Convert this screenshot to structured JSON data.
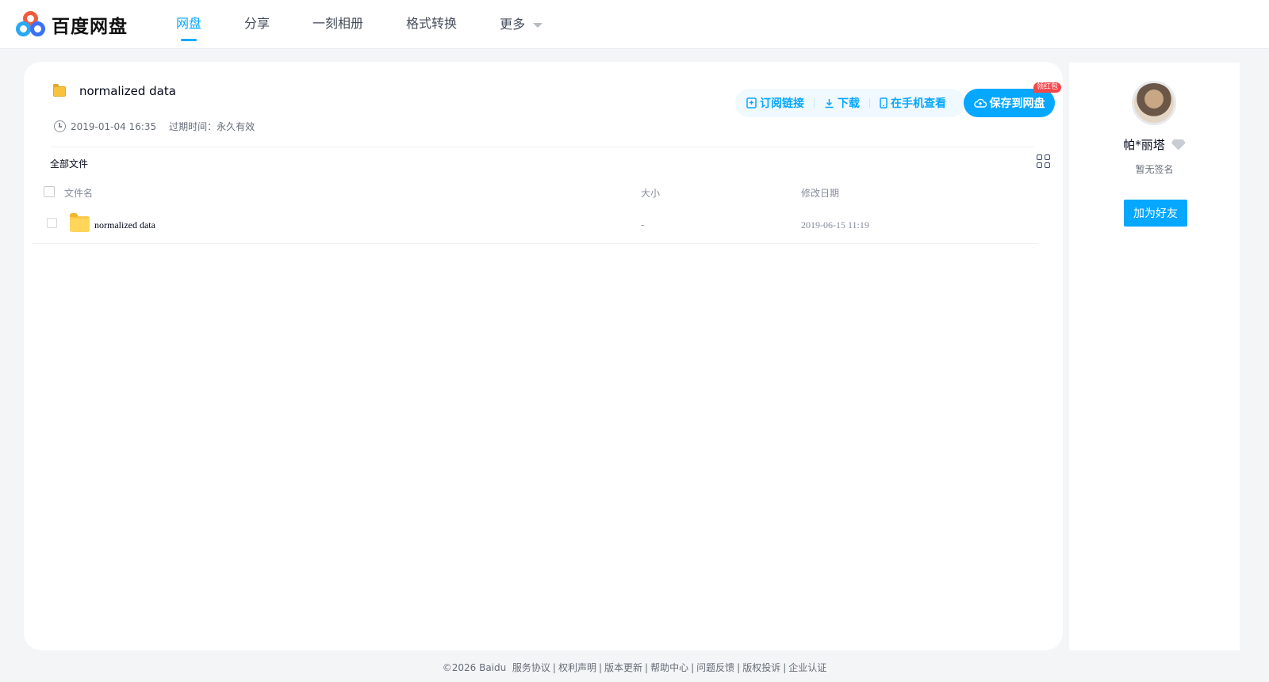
{
  "brand": {
    "name": "百度网盘"
  },
  "nav": {
    "items": [
      {
        "label": "网盘",
        "active": true
      },
      {
        "label": "分享",
        "active": false
      },
      {
        "label": "一刻相册",
        "active": false
      },
      {
        "label": "格式转换",
        "active": false
      }
    ],
    "more_label": "更多"
  },
  "share": {
    "title": "normalized data",
    "created": "2019-01-04 16:35",
    "expire": "过期时间：永久有效"
  },
  "actions": {
    "subscribe": "订阅链接",
    "download": "下载",
    "mobile": "在手机查看",
    "save": "保存到网盘",
    "redpack_badge": "领红包"
  },
  "file_list": {
    "breadcrumb": "全部文件",
    "columns": {
      "name": "文件名",
      "size": "大小",
      "date": "修改日期"
    },
    "rows": [
      {
        "name": "normalized data",
        "size": "-",
        "date": "2019-06-15 11:19",
        "type": "folder"
      }
    ]
  },
  "user": {
    "name": "帕*丽塔",
    "signature": "暂无签名",
    "add_friend": "加为好友"
  },
  "footer": {
    "copyright": "©2026 Baidu",
    "links": [
      "服务协议",
      "权利声明",
      "版本更新",
      "帮助中心",
      "问题反馈",
      "版权投诉",
      "企业认证"
    ]
  },
  "colors": {
    "accent": "#06a7ff",
    "background": "#f4f5f7",
    "badge_red": "#f5464a"
  }
}
